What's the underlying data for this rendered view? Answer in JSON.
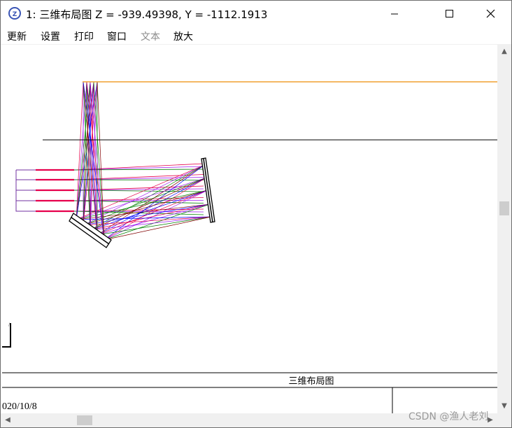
{
  "window": {
    "title": "1: 三维布局图 Z = -939.49398, Y = -1112.1913",
    "app_icon": "zemax-app-icon",
    "controls": [
      "minimize-icon",
      "maximize-icon",
      "close-icon"
    ]
  },
  "menu": [
    {
      "label": "更新",
      "enabled": true
    },
    {
      "label": "设置",
      "enabled": true
    },
    {
      "label": "打印",
      "enabled": true
    },
    {
      "label": "窗口",
      "enabled": true
    },
    {
      "label": "文本",
      "enabled": false
    },
    {
      "label": "放大",
      "enabled": true
    }
  ],
  "plot": {
    "title": "三维布局图",
    "date": "020/10/8",
    "ray_colors": [
      "#e6004c",
      "#a020f0",
      "#008000",
      "#800000",
      "#0000ff"
    ],
    "axis_color": "#f0a030"
  },
  "watermark": "CSDN @渔人老刘"
}
